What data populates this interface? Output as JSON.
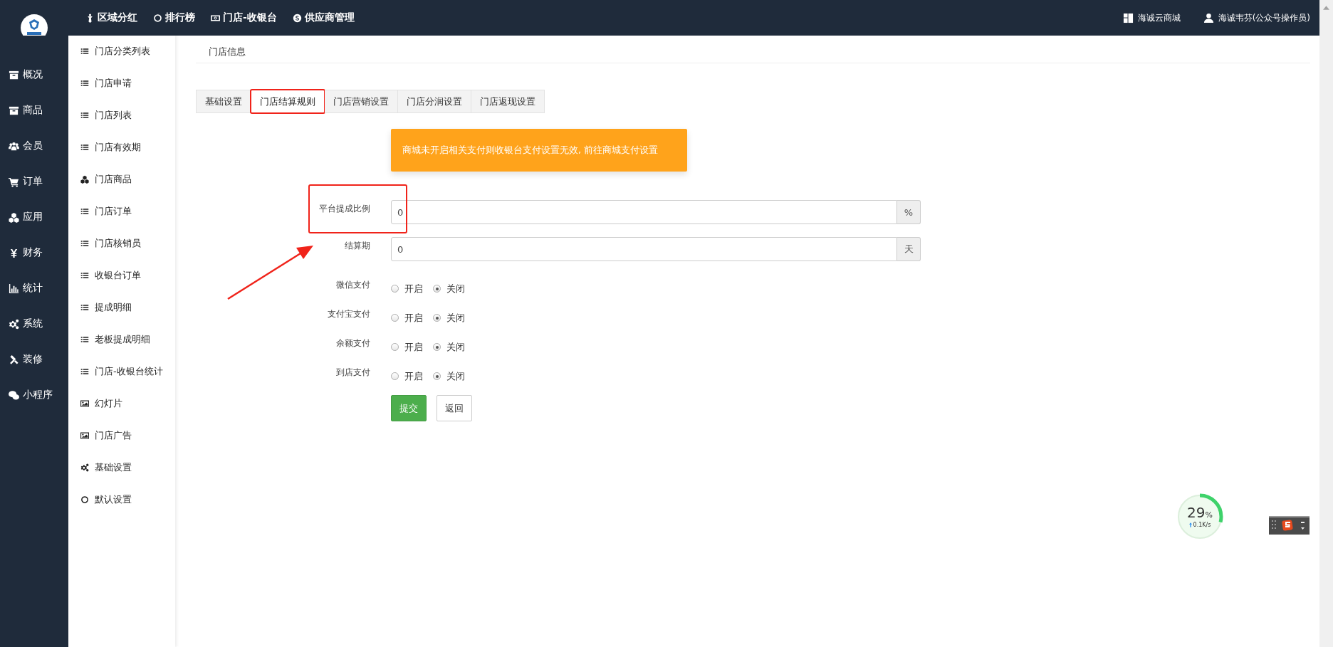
{
  "top_nav": [
    {
      "label": "区域分红"
    },
    {
      "label": "排行榜"
    },
    {
      "label": "门店-收银台"
    },
    {
      "label": "供应商管理"
    }
  ],
  "top_right": [
    {
      "label": "海诚云商城"
    },
    {
      "label": "海诚韦芬(公众号操作员)"
    }
  ],
  "sidebar": {
    "items": [
      {
        "label": "概况"
      },
      {
        "label": "商品"
      },
      {
        "label": "会员"
      },
      {
        "label": "订单"
      },
      {
        "label": "应用"
      },
      {
        "label": "财务"
      },
      {
        "label": "统计"
      },
      {
        "label": "系统"
      },
      {
        "label": "装修"
      },
      {
        "label": "小程序"
      }
    ]
  },
  "submenu": {
    "items": [
      {
        "label": "门店分类列表"
      },
      {
        "label": "门店申请"
      },
      {
        "label": "门店列表"
      },
      {
        "label": "门店有效期"
      },
      {
        "label": "门店商品"
      },
      {
        "label": "门店订单"
      },
      {
        "label": "门店核销员"
      },
      {
        "label": "收银台订单"
      },
      {
        "label": "提成明细"
      },
      {
        "label": "老板提成明细"
      },
      {
        "label": "门店-收银台统计"
      },
      {
        "label": "幻灯片"
      },
      {
        "label": "门店广告"
      },
      {
        "label": "基础设置"
      },
      {
        "label": "默认设置"
      }
    ]
  },
  "breadcrumb": "门店信息",
  "tabs": [
    {
      "label": "基础设置",
      "selected": false,
      "highlighted": false
    },
    {
      "label": "门店结算规则",
      "selected": true,
      "highlighted": true
    },
    {
      "label": "门店营销设置",
      "selected": false,
      "highlighted": false
    },
    {
      "label": "门店分润设置",
      "selected": false,
      "highlighted": false
    },
    {
      "label": "门店返现设置",
      "selected": false,
      "highlighted": false
    }
  ],
  "alert": "商城未开启相关支付则收银台支付设置无效, 前往商城支付设置",
  "fields": [
    {
      "label": "平台提成比例",
      "value": "0",
      "addon": "%",
      "highlighted": true
    },
    {
      "label": "结算期",
      "value": "0",
      "addon": "天",
      "highlighted": false
    }
  ],
  "radio_groups": [
    {
      "label": "微信支付",
      "options": [
        {
          "label": "开启",
          "selected": false
        },
        {
          "label": "关闭",
          "selected": true
        }
      ]
    },
    {
      "label": "支付宝支付",
      "options": [
        {
          "label": "开启",
          "selected": false
        },
        {
          "label": "关闭",
          "selected": true
        }
      ]
    },
    {
      "label": "余额支付",
      "options": [
        {
          "label": "开启",
          "selected": false
        },
        {
          "label": "关闭",
          "selected": true
        }
      ]
    },
    {
      "label": "到店支付",
      "options": [
        {
          "label": "开启",
          "selected": false
        },
        {
          "label": "关闭",
          "selected": true
        }
      ]
    }
  ],
  "buttons": [
    {
      "label": "提交",
      "kind": "primary"
    },
    {
      "label": "返回",
      "kind": "default"
    }
  ],
  "net_widget": {
    "percent": "29",
    "unit": "%",
    "speed": "0.1K/s",
    "level": 0.29
  }
}
